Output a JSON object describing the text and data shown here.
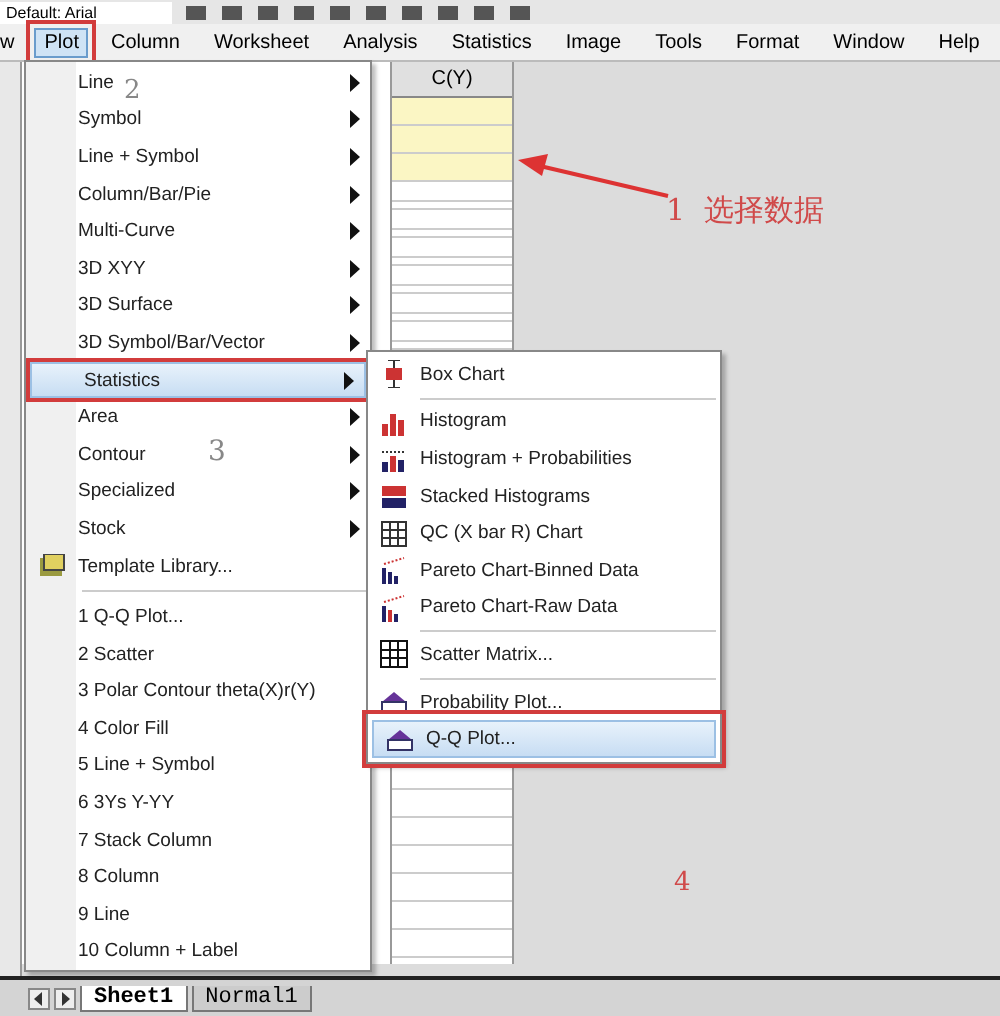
{
  "toolbar": {
    "font_field": "Default: Arial"
  },
  "menubar": [
    {
      "label": "w",
      "selected": false
    },
    {
      "label": "Plot",
      "selected": true
    },
    {
      "label": "Column",
      "selected": false
    },
    {
      "label": "Worksheet",
      "selected": false
    },
    {
      "label": "Analysis",
      "selected": false
    },
    {
      "label": "Statistics",
      "selected": false
    },
    {
      "label": "Image",
      "selected": false
    },
    {
      "label": "Tools",
      "selected": false
    },
    {
      "label": "Format",
      "selected": false
    },
    {
      "label": "Window",
      "selected": false
    },
    {
      "label": "Help",
      "selected": false
    }
  ],
  "worksheet": {
    "column": "C(Y)",
    "cells": [
      {
        "selected": true
      },
      {
        "selected": true
      },
      {
        "selected": true
      },
      {
        "selected": false
      },
      {
        "selected": false
      },
      {
        "selected": false
      },
      {
        "selected": false
      },
      {
        "selected": false
      },
      {
        "selected": false
      }
    ]
  },
  "plot_menu": {
    "items": [
      {
        "label": "Line",
        "kind": "submenu",
        "selected": false
      },
      {
        "label": "Symbol",
        "kind": "submenu",
        "selected": false
      },
      {
        "label": "Line + Symbol",
        "kind": "submenu",
        "selected": false
      },
      {
        "label": "Column/Bar/Pie",
        "kind": "submenu",
        "selected": false
      },
      {
        "label": "Multi-Curve",
        "kind": "submenu",
        "selected": false
      },
      {
        "label": "3D XYY",
        "kind": "submenu",
        "selected": false
      },
      {
        "label": "3D Surface",
        "kind": "submenu",
        "selected": false
      },
      {
        "label": "3D Symbol/Bar/Vector",
        "kind": "submenu",
        "selected": false
      },
      {
        "label": "Statistics",
        "kind": "submenu",
        "selected": true
      },
      {
        "label": "Area",
        "kind": "submenu",
        "selected": false
      },
      {
        "label": "Contour",
        "kind": "submenu",
        "selected": false
      },
      {
        "label": "Specialized",
        "kind": "submenu",
        "selected": false
      },
      {
        "label": "Stock",
        "kind": "submenu",
        "selected": false
      },
      {
        "label": "Template Library...",
        "kind": "command",
        "selected": false
      }
    ],
    "recent": [
      {
        "label": "1 Q-Q Plot..."
      },
      {
        "label": "2 Scatter"
      },
      {
        "label": "3 Polar Contour theta(X)r(Y)"
      },
      {
        "label": "4 Color Fill"
      },
      {
        "label": "5 Line + Symbol"
      },
      {
        "label": "6 3Ys Y-YY"
      },
      {
        "label": "7 Stack Column"
      },
      {
        "label": "8 Column"
      },
      {
        "label": "9 Line"
      },
      {
        "label": "10 Column + Label"
      }
    ]
  },
  "statistics_menu": {
    "groups": [
      [
        {
          "label": "Box Chart",
          "selected": false
        }
      ],
      [
        {
          "label": "Histogram",
          "selected": false
        },
        {
          "label": "Histogram + Probabilities",
          "selected": false
        },
        {
          "label": "Stacked Histograms",
          "selected": false
        },
        {
          "label": "QC (X bar R) Chart",
          "selected": false
        },
        {
          "label": "Pareto Chart-Binned Data",
          "selected": false
        },
        {
          "label": "Pareto Chart-Raw Data",
          "selected": false
        }
      ],
      [
        {
          "label": "Scatter Matrix...",
          "selected": false
        }
      ],
      [
        {
          "label": "Probability Plot...",
          "selected": false
        },
        {
          "label": "Q-Q Plot...",
          "selected": true
        }
      ]
    ]
  },
  "annotations": [
    {
      "label": "1  选择数据"
    },
    {
      "label": "2"
    },
    {
      "label": "3"
    },
    {
      "label": "4"
    }
  ],
  "sheet_tabs": [
    {
      "label": "Sheet1",
      "selected": true
    },
    {
      "label": "Normal1",
      "selected": false
    }
  ]
}
